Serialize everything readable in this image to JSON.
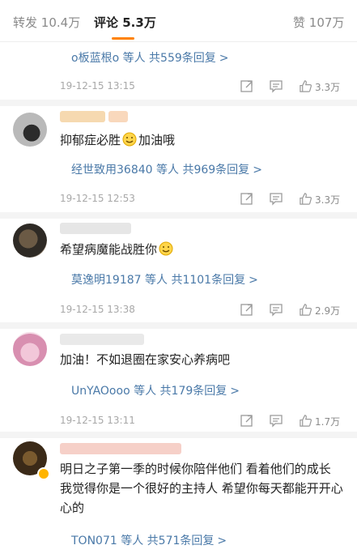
{
  "tabs": {
    "reposts_label": "转发",
    "reposts_count": "10.4万",
    "comments_label": "评论",
    "comments_count": "5.3万",
    "likes_label": "赞",
    "likes_count": "107万"
  },
  "top_reply": {
    "user": "o板蓝根o",
    "text": " 等人 ",
    "count": "共559条回复",
    "chevron": ">"
  },
  "comments": [
    {
      "meta": {
        "time": "19-12-15 13:15",
        "likes": "3.3万"
      }
    },
    {
      "text_a": "抑郁症必胜",
      "text_b": "加油哦",
      "reply_user": "经世致用36840",
      "reply_mid": " 等人 ",
      "reply_count": "共969条回复",
      "chevron": ">",
      "meta": {
        "time": "19-12-15 12:53",
        "likes": "3.3万"
      }
    },
    {
      "text_a": "希望病魔能战胜你",
      "reply_user": "莫逸明19187",
      "reply_mid": " 等人 ",
      "reply_count": "共1101条回复",
      "chevron": ">",
      "meta": {
        "time": "19-12-15 13:38",
        "likes": "2.9万"
      }
    },
    {
      "text_a": "加油！不如退圈在家安心养病吧",
      "reply_user": "UnYAOooo",
      "reply_mid": " 等人 ",
      "reply_count": "共179条回复",
      "chevron": ">",
      "meta": {
        "time": "19-12-15 13:11",
        "likes": "1.7万"
      }
    },
    {
      "text_a": "明日之子第一季的时候你陪伴他们 看着他们的成长 我觉得你是一个很好的主持人 希望你每天都能开开心心的",
      "reply_user": "TON071",
      "reply_mid": " 等人 ",
      "reply_count": "共571条回复",
      "chevron": ">"
    }
  ],
  "colors": {
    "accent": "#ff8200",
    "link": "#4a79a8",
    "muted": "#a8a8a8"
  },
  "icons": [
    "share-icon",
    "comment-icon",
    "thumb-up-icon",
    "smile-emoji-icon",
    "verified-badge-icon"
  ]
}
